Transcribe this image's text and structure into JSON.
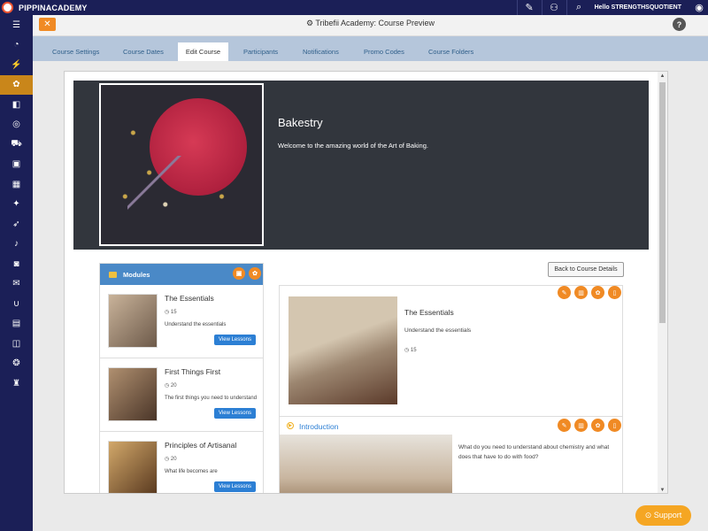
{
  "topbar": {
    "brand": "PIPPINACADEMY",
    "user_greeting": "Hello STRENGTHSQUOTIENT"
  },
  "header": {
    "close_glyph": "✕",
    "title": "⚙ Tribefii Academy: Course Preview",
    "help_glyph": "?"
  },
  "tabs": [
    {
      "label": "Course Settings"
    },
    {
      "label": "Course Dates"
    },
    {
      "label": "Edit Course",
      "active": true
    },
    {
      "label": "Participants"
    },
    {
      "label": "Notifications"
    },
    {
      "label": "Promo Codes"
    },
    {
      "label": "Course Folders"
    }
  ],
  "hero": {
    "title": "Bakestry",
    "description": "Welcome to the amazing world of the Art of Baking."
  },
  "modules": {
    "header": "Modules",
    "items": [
      {
        "title": "The Essentials",
        "meta": "◷ 15",
        "description": "Understand the essentials",
        "button": "View Lessons"
      },
      {
        "title": "First Things First",
        "meta": "◷ 20",
        "description": "The first things you need to understand",
        "button": "View Lessons"
      },
      {
        "title": "Principles of Artisanal",
        "meta": "◷ 20",
        "description": "What life becomes are",
        "button": "View Lessons"
      }
    ]
  },
  "back_button": "Back to Course Details",
  "detail": {
    "title": "The Essentials",
    "description": "Understand the essentials",
    "meta": "◷ 15"
  },
  "lesson": {
    "title": "Introduction",
    "text": "What do you need to understand about chemistry and what does that have to do with food?"
  },
  "support": "⊙ Support",
  "colors": {
    "navy": "#1b1f57",
    "orange": "#f08a24",
    "accent_blue": "#2c7fd4",
    "active_sidebar": "#c9861a"
  }
}
